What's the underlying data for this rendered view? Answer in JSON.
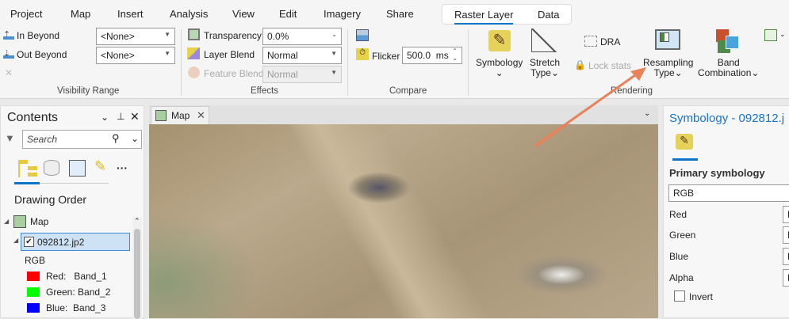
{
  "tabs": [
    "Project",
    "Map",
    "Insert",
    "Analysis",
    "View",
    "Edit",
    "Imagery",
    "Share"
  ],
  "context_tabs": [
    "Raster Layer",
    "Data"
  ],
  "visibility": {
    "in_beyond": "In Beyond",
    "out_beyond": "Out Beyond",
    "in_value": "<None>",
    "out_value": "<None>",
    "group": "Visibility Range"
  },
  "effects": {
    "transparency": "Transparency",
    "transparency_value": "0.0%",
    "layer_blend": "Layer Blend",
    "layer_blend_value": "Normal",
    "feature_blend": "Feature Blend",
    "feature_blend_value": "Normal",
    "group": "Effects"
  },
  "compare": {
    "flicker": "Flicker",
    "flicker_value": "500.0  ms",
    "group": "Compare"
  },
  "rendering": {
    "symbology": "Symbology",
    "stretch": "Stretch",
    "stretch2": "Type",
    "dra": "DRA",
    "lock": "Lock stats",
    "resampling": "Resampling",
    "resampling2": "Type",
    "band": "Band",
    "band2": "Combination",
    "group": "Rendering"
  },
  "contents": {
    "title": "Contents",
    "search_placeholder": "Search",
    "drawing_order": "Drawing Order",
    "map": "Map",
    "layer": "092812.jp2",
    "rgb": "RGB",
    "bands": [
      {
        "label": "Red:   Band_1",
        "color": "#ff0000"
      },
      {
        "label": "Green: Band_2",
        "color": "#00ff00"
      },
      {
        "label": "Blue:  Band_3",
        "color": "#0000ff"
      }
    ]
  },
  "map_tab": "Map",
  "symbology": {
    "title": "Symbology - 092812.j",
    "primary": "Primary symbology",
    "primary_value": "RGB",
    "rows": [
      {
        "label": "Red",
        "value": "B"
      },
      {
        "label": "Green",
        "value": "B"
      },
      {
        "label": "Blue",
        "value": "B"
      },
      {
        "label": "Alpha",
        "value": "N"
      }
    ],
    "invert": "Invert"
  }
}
